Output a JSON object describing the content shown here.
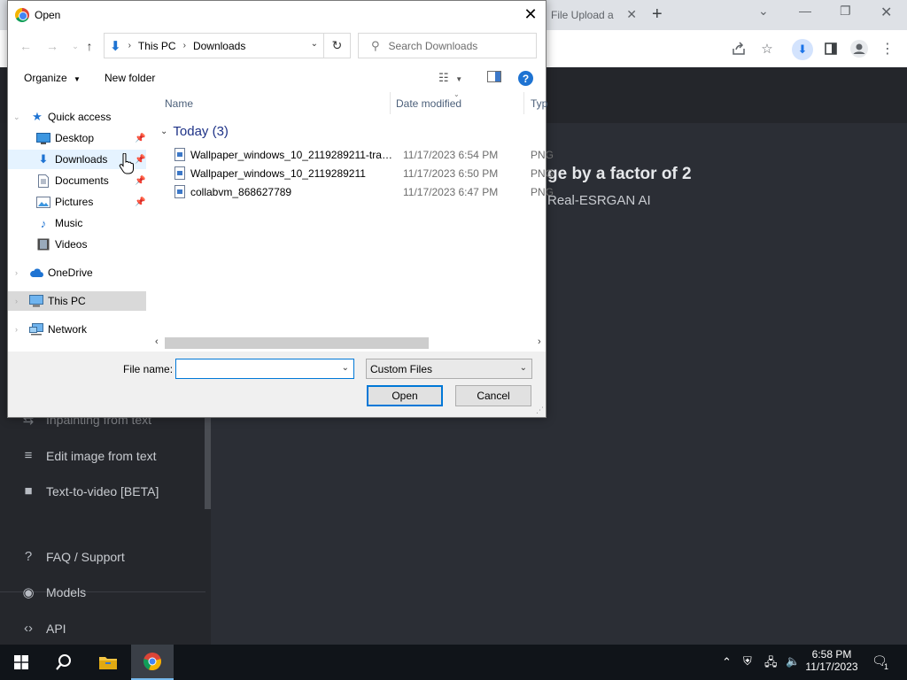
{
  "browser": {
    "tab_title": "File Upload a",
    "tab_close": "✕",
    "new_tab": "+",
    "window_controls": {
      "dropdown": "⌄",
      "minimize": "—",
      "restore": "❐",
      "close": "✕"
    },
    "toolbar_icons": [
      "share-icon",
      "star-icon",
      "download-icon",
      "side-panel-icon",
      "profile-icon",
      "menu-icon"
    ]
  },
  "webpage": {
    "heading": "ge by a factor of 2",
    "subheading": "Real-ESRGAN AI",
    "sidebar_items": [
      {
        "label": "Inpainting from text",
        "icon": "inpaint-icon"
      },
      {
        "label": "Edit image from text",
        "icon": "edit-text-icon"
      },
      {
        "label": "Text-to-video [BETA]",
        "icon": "video-icon"
      },
      {
        "label": "FAQ / Support",
        "icon": "question-icon"
      },
      {
        "label": "Models",
        "icon": "models-icon"
      },
      {
        "label": "API",
        "icon": "code-icon"
      }
    ]
  },
  "dialog": {
    "title": "Open",
    "address": {
      "root": "This PC",
      "folder": "Downloads"
    },
    "search_placeholder": "Search Downloads",
    "commands": {
      "organize": "Organize",
      "new_folder": "New folder"
    },
    "nav": {
      "quick_access": "Quick access",
      "desktop": "Desktop",
      "downloads": "Downloads",
      "documents": "Documents",
      "pictures": "Pictures",
      "music": "Music",
      "videos": "Videos",
      "onedrive": "OneDrive",
      "this_pc": "This PC",
      "network": "Network"
    },
    "columns": {
      "name": "Name",
      "date": "Date modified",
      "type": "Type"
    },
    "group_label": "Today (3)",
    "files": [
      {
        "name": "Wallpaper_windows_10_2119289211-tran...",
        "date": "11/17/2023 6:54 PM",
        "type": "PNG"
      },
      {
        "name": "Wallpaper_windows_10_2119289211",
        "date": "11/17/2023 6:50 PM",
        "type": "PNG"
      },
      {
        "name": "collabvm_868627789",
        "date": "11/17/2023 6:47 PM",
        "type": "PNG"
      }
    ],
    "file_name_label": "File name:",
    "file_name_value": "",
    "file_type": "Custom Files",
    "open_button": "Open",
    "cancel_button": "Cancel"
  },
  "taskbar": {
    "time": "6:58 PM",
    "date": "11/17/2023",
    "notification_count": "1"
  }
}
